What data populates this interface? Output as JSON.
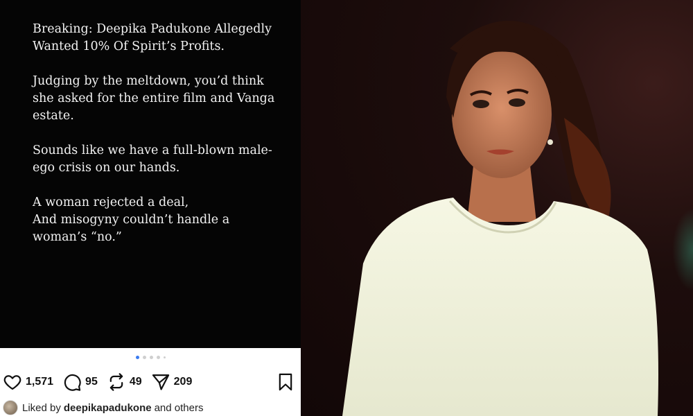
{
  "post": {
    "paragraphs": [
      "Breaking: Deepika Padukone Allegedly Wanted 10% Of Spirit’s Profits.",
      "Judging by the meltdown, you’d think she asked for the entire film and Vanga estate.",
      "Sounds like we have a full-blown male-ego crisis on our hands.",
      "A woman rejected a deal,\nAnd misogyny couldn’t handle a woman’s “no.”"
    ],
    "carousel": {
      "current": 1,
      "total": 5
    },
    "actions": {
      "likes": "1,571",
      "comments": "95",
      "reposts": "49",
      "shares": "209"
    },
    "liked_by": {
      "prefix": "Liked by",
      "user": "deepikapadukone",
      "suffix": "and others"
    }
  },
  "icons": [
    "heart-icon",
    "comment-icon",
    "repost-icon",
    "share-icon",
    "bookmark-icon"
  ],
  "colors": {
    "slide_bg": "#050505",
    "active_dot": "#3a7bf0",
    "text": "#111111"
  }
}
